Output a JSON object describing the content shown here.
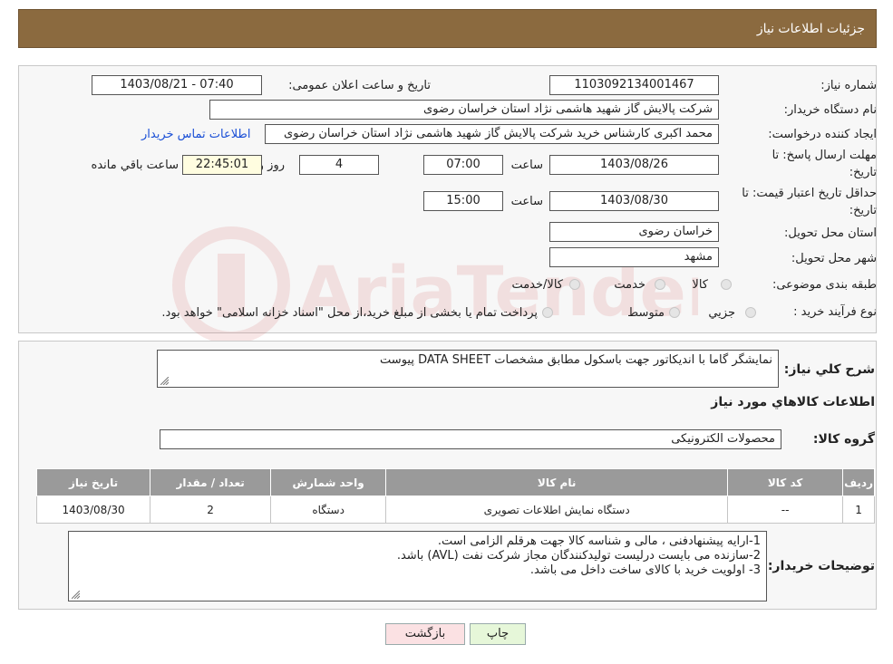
{
  "header": {
    "title": "جزئیات اطلاعات نیاز"
  },
  "info": {
    "need_number_label": "شماره نیاز:",
    "need_number": "1103092134001467",
    "announce_label": "تاریخ و ساعت اعلان عمومی:",
    "announce_value": "1403/08/21 - 07:40",
    "buyer_label": "نام دستگاه خریدار:",
    "buyer_value": "شرکت پالایش گاز شهید هاشمی نژاد   استان خراسان رضوی",
    "creator_label": "ایجاد کننده درخواست:",
    "creator_value": "محمد اکبری کارشناس خرید شرکت پالایش گاز شهید هاشمی نژاد   استان خراسان رضوی",
    "contact_link": "اطلاعات تماس خریدار",
    "deadline_label_1": "مهلت ارسال پاسخ: تا",
    "deadline_label_2": "تاریخ:",
    "deadline_date": "1403/08/26",
    "time_label": "ساعت",
    "deadline_time": "07:00",
    "days_value": "4",
    "days_label": "روز و",
    "remaining_value": "22:45:01",
    "remaining_label": "ساعت باقي مانده",
    "validity_label_1": "حداقل تاریخ اعتبار قیمت: تا",
    "validity_label_2": "تاریخ:",
    "validity_date": "1403/08/30",
    "validity_time": "15:00",
    "province_label": "استان محل تحویل:",
    "province_value": "خراسان رضوی",
    "city_label": "شهر محل تحویل:",
    "city_value": "مشهد",
    "category_label": "طبقه بندی موضوعی:",
    "category_options": [
      "کالا",
      "خدمت",
      "کالا/خدمت"
    ],
    "process_label": "نوع فرآیند خرید :",
    "process_options": [
      "جزیي",
      "متوسط"
    ],
    "process_note": "پرداخت تمام یا بخشی از مبلغ خرید،از محل \"اسناد خزانه اسلامی\" خواهد بود."
  },
  "summary": {
    "label": "شرح کلي نياز:",
    "value": "نمایشگر گاما با اندیکاتور جهت باسکول مطابق مشخصات DATA SHEET پیوست",
    "items_title": "اطلاعات کالاهاي مورد نياز",
    "group_label": "گروه کالا:",
    "group_value": "محصولات الکترونیکی"
  },
  "table": {
    "headers": [
      "رديف",
      "کد کالا",
      "نام کالا",
      "واحد شمارش",
      "تعداد / مقدار",
      "تاریخ نیاز"
    ],
    "rows": [
      [
        "1",
        "--",
        "دستگاه نمایش اطلاعات تصویری",
        "دستگاه",
        "2",
        "1403/08/30"
      ]
    ]
  },
  "notes": {
    "label": "توضیحات خریدار:",
    "lines": [
      "1-ارایه پیشنهادفنی ، مالی و شناسه کالا جهت هرقلم الزامی است.",
      "2-سازنده می بایست درلیست تولیدکنندگان مجاز شرکت نفت (AVL)  باشد.",
      "3- اولویت خرید  با کالای ساخت  داخل می باشد."
    ]
  },
  "buttons": {
    "print": "چاپ",
    "back": "بازگشت"
  },
  "watermark": {
    "text": "AriaTender.neT"
  },
  "colors": {
    "header_bg": "#8b6a3f",
    "table_header_bg": "#9a9a9a",
    "link": "#1a4fd6",
    "back_button_bg": "#fbe1e3",
    "print_button_bg": "#e6f7d9"
  }
}
